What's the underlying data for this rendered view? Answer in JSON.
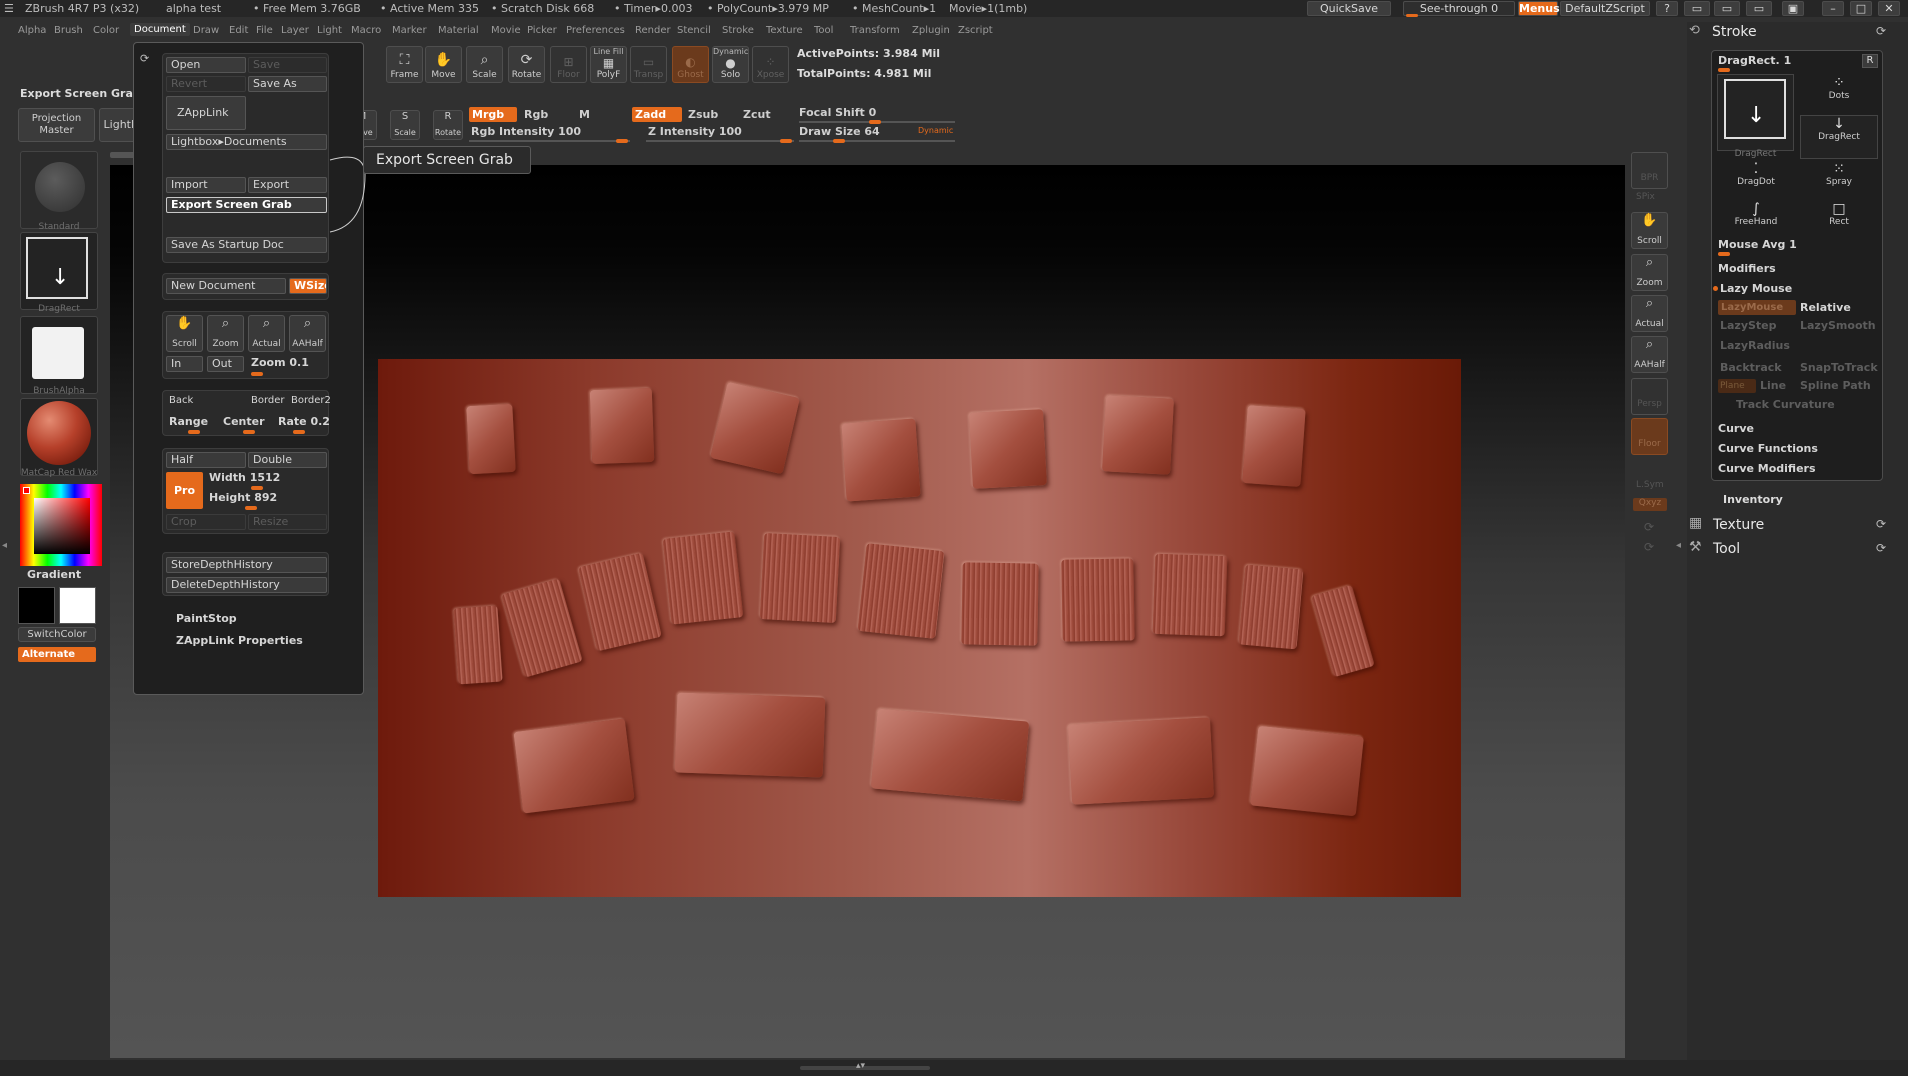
{
  "titlebar": {
    "app_title": "ZBrush 4R7 P3 (x32)",
    "doc_name": "alpha test",
    "free_mem": "• Free Mem 3.76GB",
    "active_mem": "• Active Mem 335",
    "scratch_disk": "• Scratch Disk 668",
    "timer": "• Timer▸0.003",
    "polycount": "• PolyCount▸3.979 MP",
    "meshcount": "• MeshCount▸1",
    "movie": "Movie▸1(1mb)",
    "quicksave": "QuickSave",
    "see_through": "See-through  0",
    "menus": "Menus",
    "script": "DefaultZScript"
  },
  "menubar": {
    "items": [
      "Alpha",
      "Brush",
      "Color",
      "Document",
      "Draw",
      "Edit",
      "File",
      "Layer",
      "Light",
      "Macro",
      "Marker",
      "Material",
      "Movie",
      "Picker",
      "Preferences",
      "Render",
      "Stencil",
      "Stroke",
      "Texture",
      "Tool",
      "Transform",
      "Zplugin",
      "Zscript"
    ],
    "active": "Document"
  },
  "left_shelf": {
    "export_label": "Export Screen Grab",
    "projection_master": "Projection Master",
    "lightbox": "LightBox",
    "standard_label": "Standard",
    "dragrect_label": "DragRect",
    "brushalpha_label": "BrushAlpha",
    "matcap_label": "MatCap Red Wax",
    "gradient": "Gradient",
    "switchcolor": "SwitchColor",
    "alternate": "Alternate"
  },
  "toolbar": {
    "frame": "Frame",
    "move": "Move",
    "scale": "Scale",
    "rotate": "Rotate",
    "floor": "Floor",
    "polyf": "PolyF",
    "polyf_top": "Line Fill",
    "transp": "Transp",
    "ghost": "Ghost",
    "solo": "Solo",
    "solo_top": "Dynamic",
    "xpose": "Xpose",
    "active_points": "ActivePoints: 3.984 Mil",
    "total_points": "TotalPoints: 4.981 Mil",
    "move2": "Move",
    "scale2": "Scale",
    "rotate2": "Rotate",
    "mrgb": "Mrgb",
    "rgb": "Rgb",
    "m": "M",
    "zadd": "Zadd",
    "zsub": "Zsub",
    "zcut": "Zcut",
    "focal_shift": "Focal Shift 0",
    "rgb_intensity": "Rgb Intensity 100",
    "z_intensity": "Z Intensity 100",
    "draw_size": "Draw Size 64",
    "dynamic": "Dynamic"
  },
  "doc_menu": {
    "open": "Open",
    "save": "Save",
    "revert": "Revert",
    "save_as": "Save As",
    "zapplink": "ZAppLink",
    "lightbox_documents": "Lightbox▸Documents",
    "import": "Import",
    "export": "Export",
    "export_screen_grab": "Export Screen Grab",
    "save_startup": "Save As Startup Doc",
    "new_document": "New Document",
    "wsize": "WSize",
    "scroll": "Scroll",
    "zoom": "Zoom",
    "actual": "Actual",
    "aahalf": "AAHalf",
    "in": "In",
    "out": "Out",
    "zoom_val": "Zoom 0.1",
    "back": "Back",
    "border": "Border",
    "border2": "Border2",
    "range": "Range",
    "center": "Center",
    "rate": "Rate 0.2",
    "half": "Half",
    "double": "Double",
    "pro": "Pro",
    "width": "Width 1512",
    "height": "Height 892",
    "crop": "Crop",
    "resize": "Resize",
    "store_depth": "StoreDepthHistory",
    "delete_depth": "DeleteDepthHistory",
    "paintstop": "PaintStop",
    "zapplink_props": "ZAppLink Properties"
  },
  "tooltip": {
    "text": "Export Screen Grab"
  },
  "right_column": {
    "bpr": "BPR",
    "spix": "SPix",
    "scroll": "Scroll",
    "zoom": "Zoom",
    "actual": "Actual",
    "aahalf": "AAHalf",
    "persp": "Persp",
    "floor": "Floor",
    "lsym": "L.Sym",
    "xyz": "Qxyz"
  },
  "stroke_panel": {
    "title": "Stroke",
    "drag_rect": "DragRect. 1",
    "r_btn": "R",
    "dots": "Dots",
    "dragrect_a": "DragRect",
    "dragrect_b": "DragRect",
    "dragdot": "DragDot",
    "spray": "Spray",
    "freehand": "FreeHand",
    "rect": "Rect",
    "mouse_avg": "Mouse Avg 1",
    "modifiers": "Modifiers",
    "lazy_mouse": "Lazy Mouse",
    "lazymouse_btn": "LazyMouse",
    "relative": "Relative",
    "lazystep": "LazyStep",
    "lazysmooth": "LazySmooth",
    "lazyradius": "LazyRadius",
    "backtrack": "Backtrack",
    "snaptotrack": "SnapToTrack",
    "plane": "Plane",
    "line": "Line",
    "spline_path": "Spline Path",
    "track_curvature": "Track Curvature",
    "curve": "Curve",
    "curve_functions": "Curve Functions",
    "curve_modifiers": "Curve Modifiers",
    "inventory": "Inventory",
    "texture": "Texture",
    "tool": "Tool"
  }
}
